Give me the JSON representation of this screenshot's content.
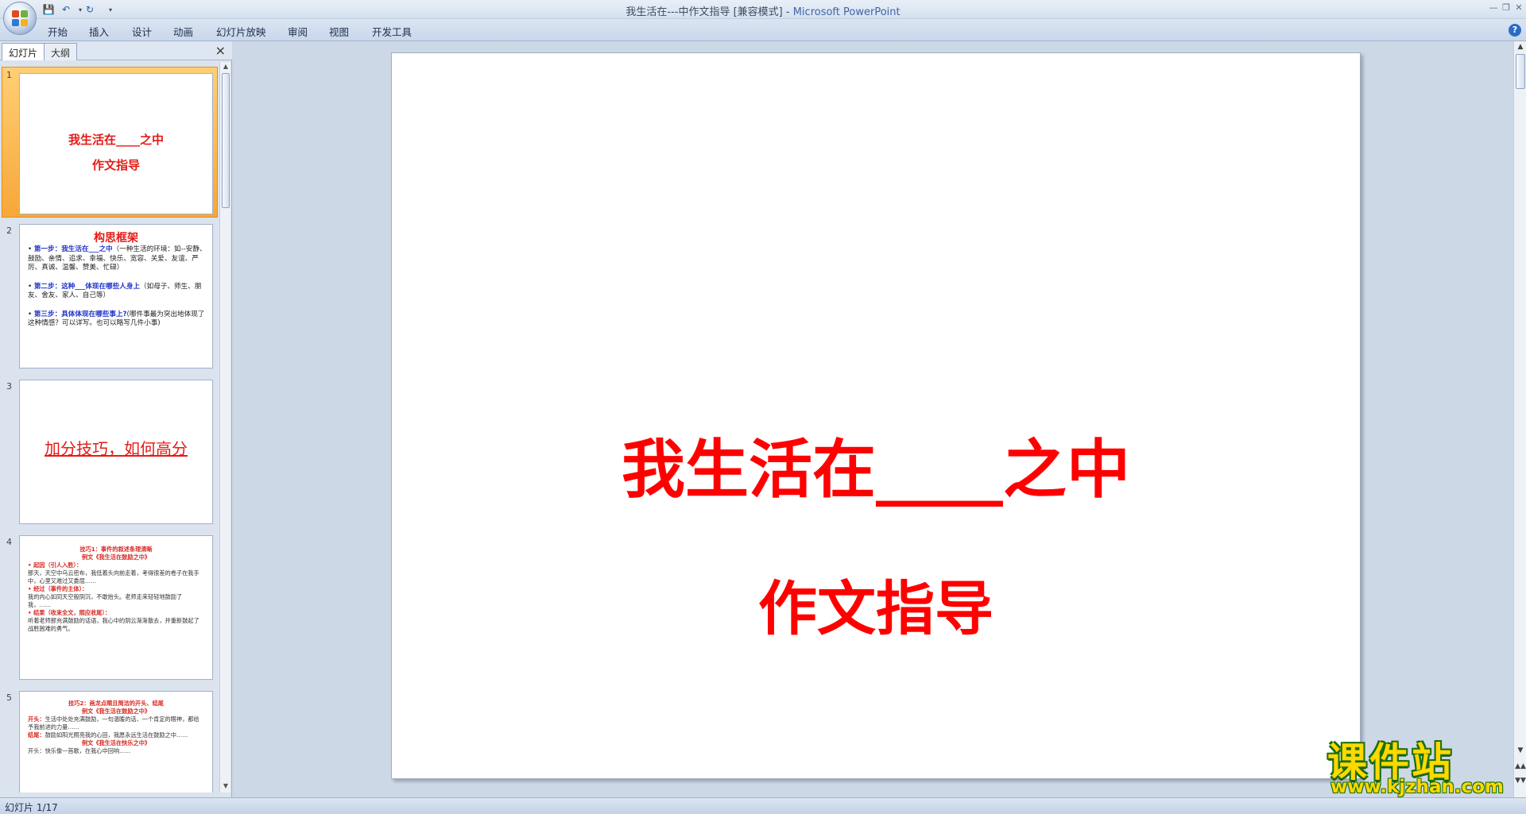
{
  "window": {
    "title_doc": "我生活在---中作文指导 [兼容模式]",
    "title_sep": " - ",
    "title_app": "Microsoft PowerPoint"
  },
  "ribbon": {
    "tabs": [
      {
        "label": "开始"
      },
      {
        "label": "插入"
      },
      {
        "label": "设计"
      },
      {
        "label": "动画"
      },
      {
        "label": "幻灯片放映"
      },
      {
        "label": "审阅"
      },
      {
        "label": "视图"
      },
      {
        "label": "开发工具"
      }
    ],
    "help_label": "?"
  },
  "panel": {
    "tab_slides": "幻灯片",
    "tab_outline": "大纲",
    "close_label": "×"
  },
  "thumbnails": [
    {
      "number": "1",
      "line1": "我生活在____之中",
      "line2": "作文指导"
    },
    {
      "number": "2",
      "heading": "构思框架",
      "b1_bold": "第一步：我生活在___之中",
      "b1_rest": "（一种生活的环境：如--安静、鼓励、亲情、追求、幸福、快乐、宽容、关爱、友谊、严厉、真诚、温馨、赞美、忙碌）",
      "b2_bold": "第二步：这种___体现在哪些人身上",
      "b2_rest": "（如母子、师生、朋友、舍友、家人、自己等）",
      "b3_bold": "第三步：具体体现在哪些事上?",
      "b3_rest": "(哪件事最为突出地体现了这种情感？可以详写。也可以略写几件小事)"
    },
    {
      "number": "3",
      "text": "加分技巧，如何高分"
    },
    {
      "number": "4",
      "h1": "技巧1：事件的叙述条理清晰",
      "h2": "例文《我生活在鼓励之中》",
      "l1": "• 起因（引人入胜）：",
      "l2": "那天，天空中乌云密布，我低着头向前走着，考得很差的卷子在我手中，心里又难过又委屈……",
      "l3": "• 经过（事件的主体）：",
      "l4": "我的内心如同天空般阴沉，不敢抬头。老师走来轻轻地鼓励了我，……",
      "l5": "• 结果（收束全文，照应收尾）：",
      "l6": "听着老师那充满鼓励的话语，我心中的阴云渐渐散去，并重新鼓起了战胜困难的勇气。"
    },
    {
      "number": "5",
      "h1": "技巧2：画龙点睛且简洁的开头、结尾",
      "h2": "例文《我生活在鼓励之中》",
      "l1": "开头：",
      "l2": "生活中处处充满鼓励，一句温暖的话、一个肯定的眼神，都给予我前进的力量……",
      "l3": "结尾：",
      "l4": "鼓励如阳光照亮我的心田，我愿永远生活在鼓励之中……",
      "h3": "例文《我生活在快乐之中》",
      "l5": "开头：快乐像一首歌，在我心中回响……"
    }
  ],
  "slide": {
    "title": "我生活在____之中",
    "subtitle": "作文指导"
  },
  "status": {
    "text": "幻灯片 1/17"
  },
  "watermark": {
    "main": "课件站",
    "url": "www.kjzhan.com"
  }
}
